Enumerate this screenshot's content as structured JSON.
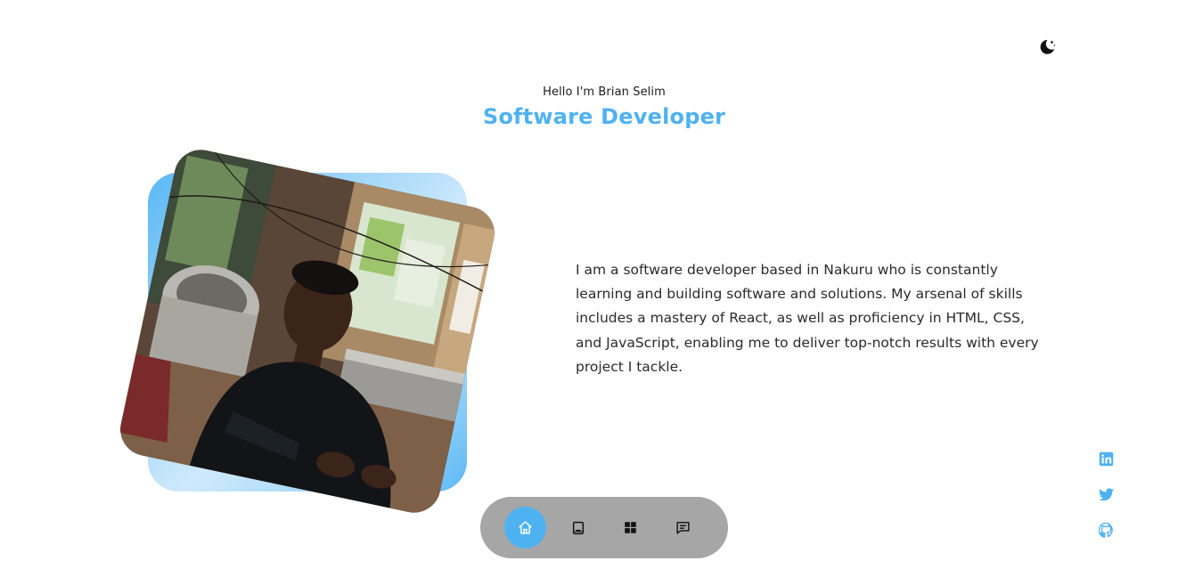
{
  "theme": {
    "icon": "moon-stars-icon"
  },
  "hero": {
    "greeting": "Hello I'm Brian Selim",
    "title": "Software Developer"
  },
  "about": {
    "bio": "I am a software developer based in Nakuru who is constantly learning and building software and solutions. My arsenal of skills includes a mastery of React, as well as proficiency in HTML, CSS, and JavaScript, enabling me to deliver top-notch results with every project I tackle."
  },
  "nav": {
    "items": [
      {
        "icon": "home-icon",
        "active": true
      },
      {
        "icon": "book-icon",
        "active": false
      },
      {
        "icon": "grid-icon",
        "active": false
      },
      {
        "icon": "message-icon",
        "active": false
      }
    ]
  },
  "socials": [
    {
      "icon": "linkedin-icon"
    },
    {
      "icon": "twitter-icon"
    },
    {
      "icon": "github-icon"
    }
  ],
  "colors": {
    "accent": "#4fb2f0",
    "nav_background": "#a6a6a6",
    "text": "#2a2a2a"
  }
}
